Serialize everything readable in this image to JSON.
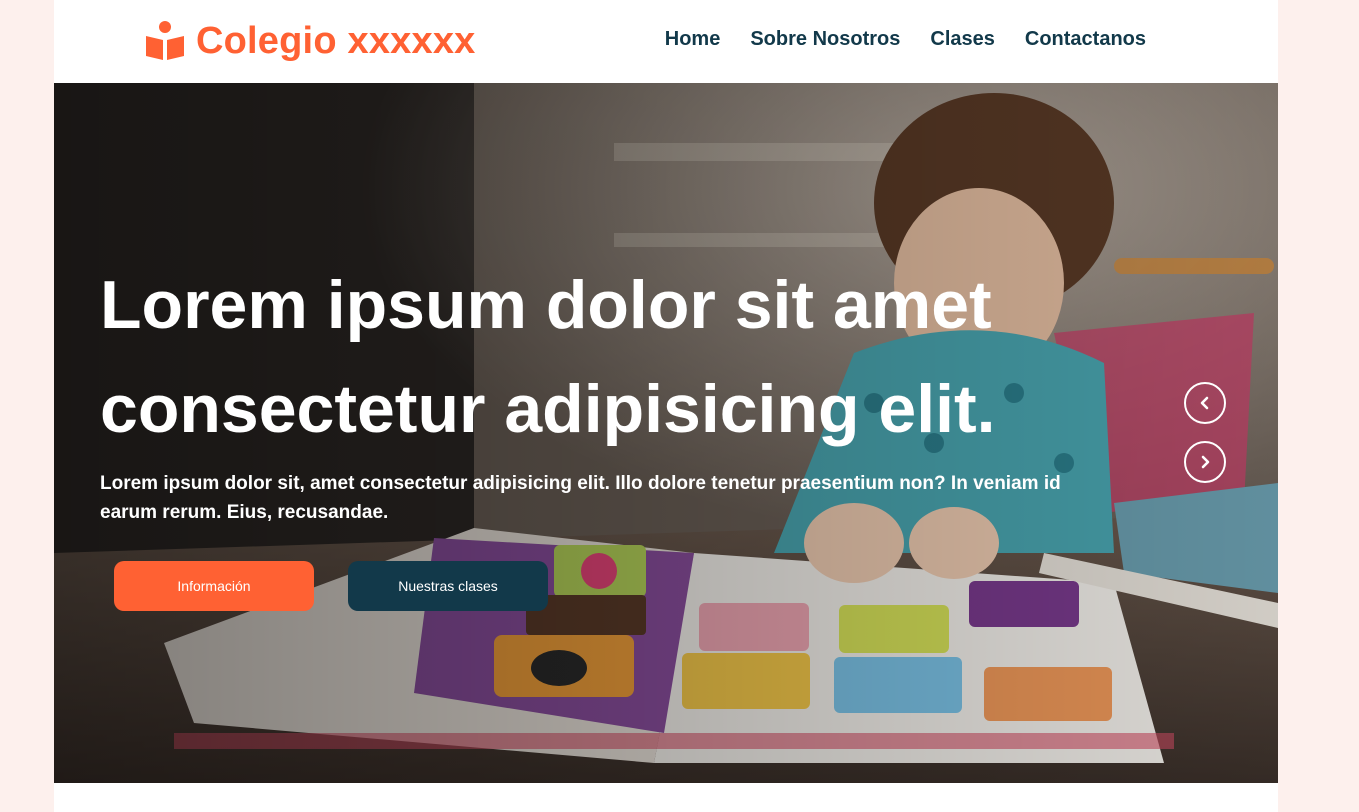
{
  "header": {
    "brand": "Colegio xxxxxx",
    "brand_icon": "book-reader-icon",
    "nav": [
      "Home",
      "Sobre Nosotros",
      "Clases",
      "Contactanos"
    ]
  },
  "hero": {
    "photo": "child-reading-picture-book",
    "title_line1": "Lorem ipsum dolor sit amet",
    "title_line2": "consectetur adipisicing elit.",
    "subtitle": "Lorem ipsum dolor sit, amet consectetur adipisicing elit. Illo dolore tenetur praesentium non? In veniam id earum rerum. Eius, recusandae.",
    "button_primary": "Información",
    "button_secondary": "Nuestras clases",
    "prev_icon": "chevron-left-icon",
    "next_icon": "chevron-right-icon"
  },
  "colors": {
    "accent": "#ff6133",
    "dark": "#12394a",
    "page_bg": "#fdf0ed"
  }
}
